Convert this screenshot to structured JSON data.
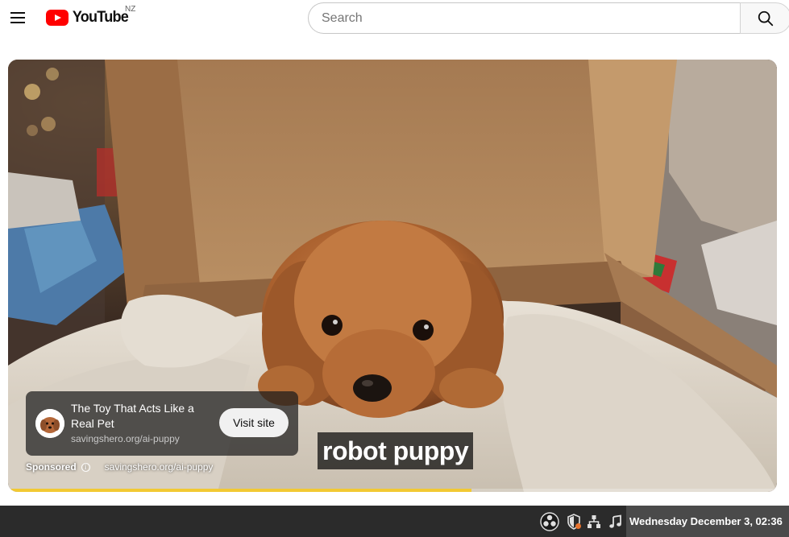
{
  "header": {
    "logo_text": "YouTube",
    "country_code": "NZ",
    "search_placeholder": "Search",
    "search_value": ""
  },
  "player": {
    "ad": {
      "title": "The Toy That Acts Like a Real Pet",
      "url": "savingshero.org/ai-puppy",
      "visit_label": "Visit site",
      "sponsored_label": "Sponsored",
      "sponsored_url": "savingshero.org/ai-puppy"
    },
    "caption": "robot puppy",
    "progress_fraction": 0.603,
    "progress_color": "#f2c933"
  },
  "taskbar": {
    "tray_icons": [
      "obs-icon",
      "shield-update-icon",
      "network-icon",
      "music-note-icon"
    ],
    "clock": "Wednesday December  3, 02:36"
  },
  "colors": {
    "brand_red": "#ff0000",
    "taskbar_bg": "#2b2b2b"
  }
}
